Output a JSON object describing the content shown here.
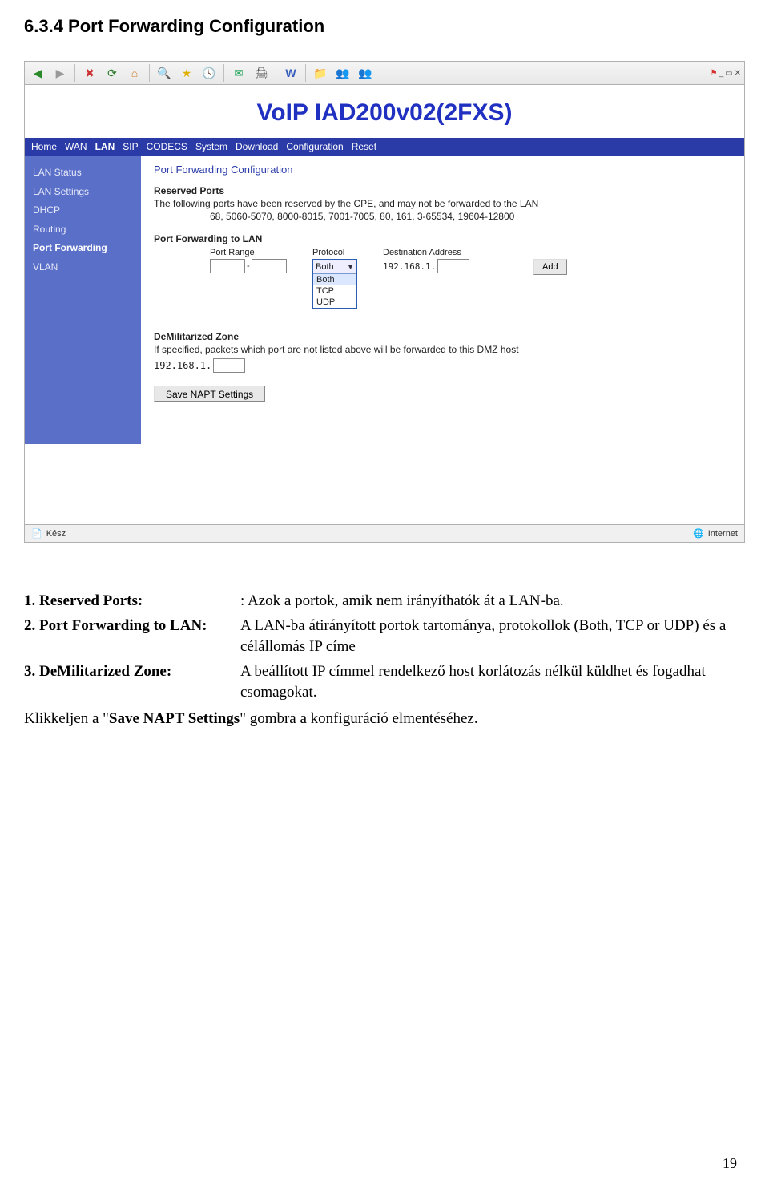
{
  "section_title": "6.3.4 Port Forwarding Configuration",
  "toolbar": {
    "icons": [
      "back",
      "fwd",
      "stop",
      "refresh",
      "home",
      "search",
      "fav",
      "history",
      "mail",
      "print",
      "word",
      "folder",
      "people1",
      "people2"
    ],
    "win_flag": "⊞",
    "win_restore": "▭",
    "win_close": "✕"
  },
  "router": {
    "title": "VoIP IAD200v02(2FXS)",
    "nav": [
      {
        "label": "Home",
        "active": false
      },
      {
        "label": "WAN",
        "active": false
      },
      {
        "label": "LAN",
        "active": true
      },
      {
        "label": "SIP",
        "active": false
      },
      {
        "label": "CODECS",
        "active": false
      },
      {
        "label": "System",
        "active": false
      },
      {
        "label": "Download",
        "active": false
      },
      {
        "label": "Configuration",
        "active": false
      },
      {
        "label": "Reset",
        "active": false
      }
    ],
    "sidebar": [
      {
        "label": "LAN Status",
        "active": false
      },
      {
        "label": "LAN Settings",
        "active": false
      },
      {
        "label": "DHCP",
        "active": false
      },
      {
        "label": "Routing",
        "active": false
      },
      {
        "label": "Port Forwarding",
        "active": true
      },
      {
        "label": "VLAN",
        "active": false
      }
    ],
    "content": {
      "title": "Port Forwarding Configuration",
      "reserved_head": "Reserved Ports",
      "reserved_text": "The following ports have been reserved by the CPE, and may not be forwarded to the LAN",
      "reserved_values": "68, 5060-5070, 8000-8015, 7001-7005, 80, 161, 3-65534, 19604-12800",
      "pf_head": "Port Forwarding to LAN",
      "cols": {
        "range": "Port Range",
        "proto": "Protocol",
        "dest": "Destination Address"
      },
      "port_from": "",
      "port_to": "",
      "proto_selected": "Both",
      "proto_options": [
        "Both",
        "TCP",
        "UDP"
      ],
      "dest_prefix": "192.168.1.",
      "dest_last": "",
      "add_label": "Add",
      "dmz_head": "DeMilitarized Zone",
      "dmz_text": "If specified, packets which port are not listed above will be forwarded to this DMZ host",
      "dmz_prefix": "192.168.1.",
      "dmz_last": "",
      "save_label": "Save NAPT Settings"
    }
  },
  "statusbar": {
    "left_icon": "📄",
    "left_text": "Kész",
    "right_icon": "🌐",
    "right_text": "Internet"
  },
  "desc": {
    "items": [
      {
        "lbl": "1. Reserved Ports:",
        "txt": ": Azok a portok, amik nem irányíthatók át a LAN-ba."
      },
      {
        "lbl": "2. Port Forwarding to LAN:",
        "txt": "A LAN-ba átirányított portok tartománya, protokollok (Both, TCP or UDP) és a célállomás IP címe"
      },
      {
        "lbl": "3. DeMilitarized Zone:",
        "txt": "A beállított IP címmel rendelkező host korlátozás nélkül küldhet és fogadhat csomagokat."
      }
    ],
    "save_prefix": "Klikkeljen a \"",
    "save_bold": "Save NAPT Settings",
    "save_suffix": "\" gombra a konfiguráció elmentéséhez."
  },
  "page_number": "19"
}
